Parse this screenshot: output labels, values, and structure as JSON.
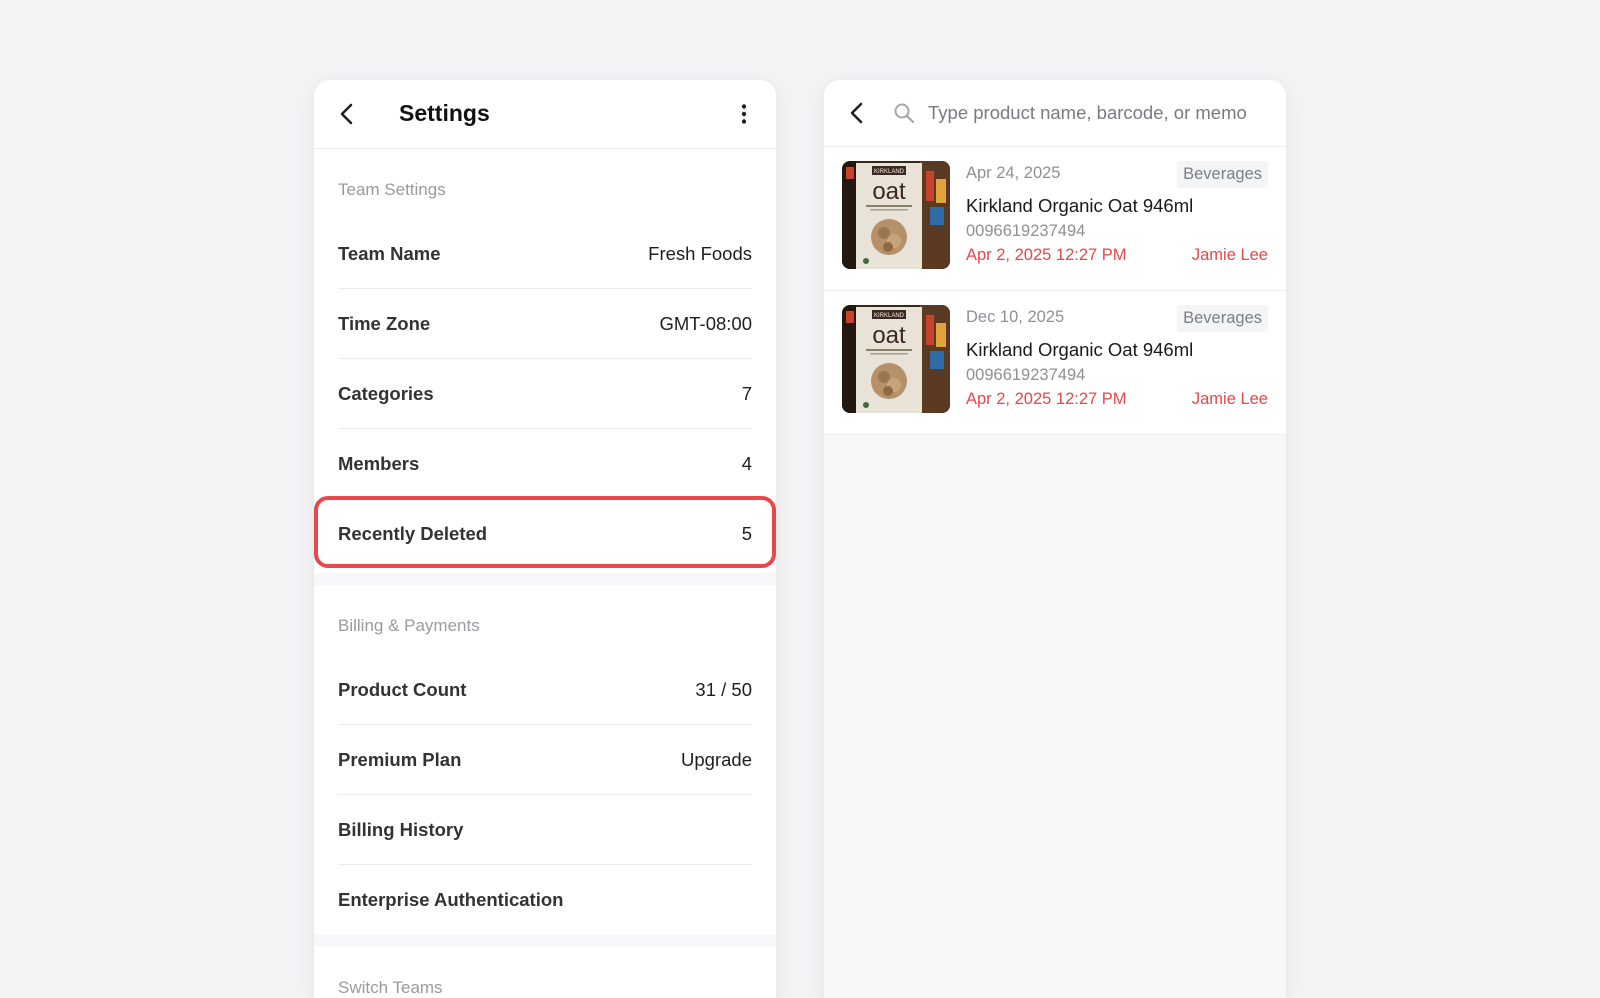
{
  "settings": {
    "title": "Settings",
    "team_section": {
      "label": "Team Settings",
      "rows": [
        {
          "label": "Team Name",
          "value": "Fresh Foods"
        },
        {
          "label": "Time Zone",
          "value": "GMT-08:00"
        },
        {
          "label": "Categories",
          "value": "7"
        },
        {
          "label": "Members",
          "value": "4"
        },
        {
          "label": "Recently Deleted",
          "value": "5"
        }
      ]
    },
    "billing_section": {
      "label": "Billing & Payments",
      "rows": [
        {
          "label": "Product Count",
          "value": "31 / 50"
        },
        {
          "label": "Premium Plan",
          "value": "Upgrade"
        },
        {
          "label": "Billing History",
          "value": ""
        },
        {
          "label": "Enterprise Authentication",
          "value": ""
        }
      ]
    },
    "switch_section": {
      "label": "Switch Teams"
    }
  },
  "deleted": {
    "search_placeholder": "Type product name, barcode, or memo",
    "items": [
      {
        "date": "Apr 24, 2025",
        "category": "Beverages",
        "name": "Kirkland Organic Oat 946ml",
        "barcode": "0096619237494",
        "deleted_at": "Apr 2, 2025 12:27 PM",
        "deleted_by": "Jamie Lee",
        "thumb_brand": "KIRKLAND",
        "thumb_word": "oat"
      },
      {
        "date": "Dec 10, 2025",
        "category": "Beverages",
        "name": "Kirkland Organic Oat 946ml",
        "barcode": "0096619237494",
        "deleted_at": "Apr 2, 2025 12:27 PM",
        "deleted_by": "Jamie Lee",
        "thumb_brand": "KIRKLAND",
        "thumb_word": "oat"
      }
    ]
  },
  "colors": {
    "highlight": "#e8474c",
    "accent_red": "#e8474c",
    "background": "#f4f4f7"
  }
}
